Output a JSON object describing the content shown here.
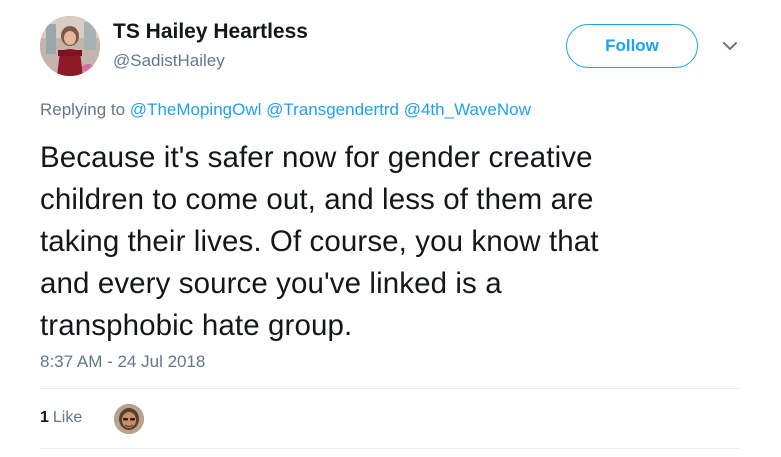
{
  "user": {
    "display_name": "TS Hailey Heartless",
    "handle": "@SadistHailey"
  },
  "actions": {
    "follow_label": "Follow",
    "more_icon": "chevron-down-icon"
  },
  "reply": {
    "prefix": "Replying to",
    "mentions": [
      "@TheMopingOwl",
      "@Transgendertrd",
      "@4th_WaveNow"
    ]
  },
  "tweet": {
    "lines": [
      "Because it's safer now for gender creative",
      "children to come out, and less of them are",
      "taking their lives. Of course, you know that",
      "and every source you've linked is a",
      "transphobic hate group."
    ],
    "timestamp": "8:37 AM - 24 Jul 2018"
  },
  "stats": {
    "like_count": "1",
    "like_label": "Like"
  },
  "colors": {
    "accent": "#1da1f2",
    "text": "#14171a",
    "muted": "#657786",
    "divider": "#e6ecf0"
  }
}
